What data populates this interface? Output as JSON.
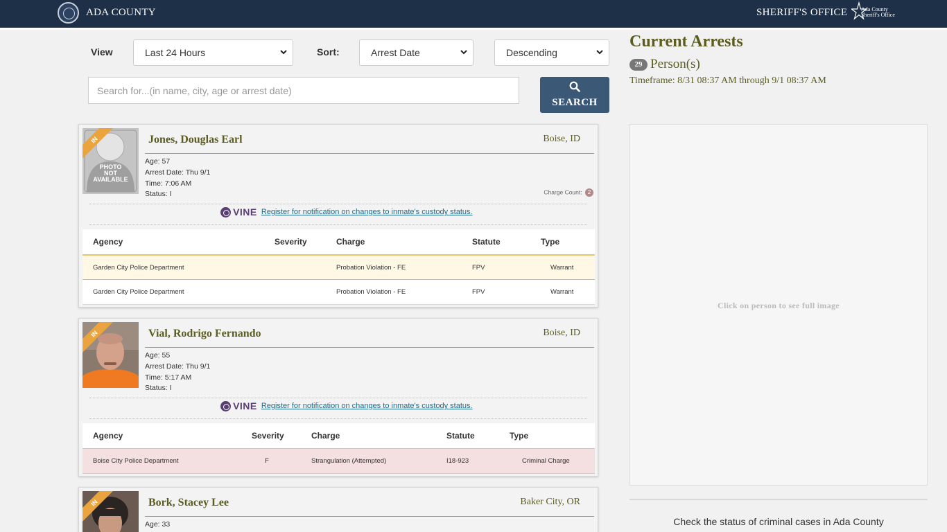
{
  "header": {
    "left_title": "ADA COUNTY",
    "right_title": "SHERIFF'S OFFICE",
    "badge_text": "Ada County\nSheriff's Office"
  },
  "controls": {
    "view_label": "View",
    "view_value": "Last 24 Hours",
    "sort_label": "Sort:",
    "sort_value": "Arrest Date",
    "order_value": "Descending",
    "search_placeholder": "Search for...(in name, city, age or arrest date)",
    "search_button": "SEARCH"
  },
  "table_headers": {
    "agency": "Agency",
    "severity": "Severity",
    "charge": "Charge",
    "statute": "Statute",
    "type": "Type"
  },
  "ribbon": "IN",
  "vine": {
    "brand": "VINE",
    "link_text": " Register for notification on changes to inmate's custody status."
  },
  "photo_placeholder": "PHOTO\nNOT\nAVAILABLE",
  "persons": [
    {
      "name": "Jones, Douglas Earl",
      "city": "Boise, ID",
      "age": "Age: 57",
      "arrest_date": "Arrest Date: Thu 9/1",
      "time": "Time: 7:06 AM",
      "status": "Status: I",
      "charge_count_label": "Charge Count:",
      "charge_count": "2",
      "charges": [
        {
          "agency": "Garden City Police Department",
          "severity": "",
          "charge": "Probation Violation - FE",
          "statute": "FPV",
          "type": "Warrant"
        },
        {
          "agency": "Garden City Police Department",
          "severity": "",
          "charge": "Probation Violation - FE",
          "statute": "FPV",
          "type": "Warrant"
        }
      ]
    },
    {
      "name": "Vial, Rodrigo Fernando",
      "city": "Boise, ID",
      "age": "Age: 55",
      "arrest_date": "Arrest Date: Thu 9/1",
      "time": "Time: 5:17 AM",
      "status": "Status: I",
      "charges": [
        {
          "agency": "Boise City Police Department",
          "severity": "F",
          "charge": "Strangulation (Attempted)",
          "statute": "I18-923",
          "type": "Criminal Charge"
        }
      ]
    },
    {
      "name": "Bork, Stacey Lee",
      "city": "Baker City, OR",
      "age": "Age: 33"
    }
  ],
  "summary": {
    "title": "Current Arrests",
    "count": "29",
    "count_label": "Person(s)",
    "timeframe": "Timeframe: 8/31 08:37 AM through 9/1 08:37 AM"
  },
  "image_panel": {
    "hint": "Click on person to see full image"
  },
  "cases_text": "Check the status of criminal cases in Ada County",
  "colors": {
    "header_bg": "#1d3047",
    "accent_olive": "#5c5c1e",
    "ribbon": "#e9a440",
    "search_btn": "#3b5876",
    "row_yellow": "#fff8e4",
    "row_pink": "#f4dfe1"
  }
}
